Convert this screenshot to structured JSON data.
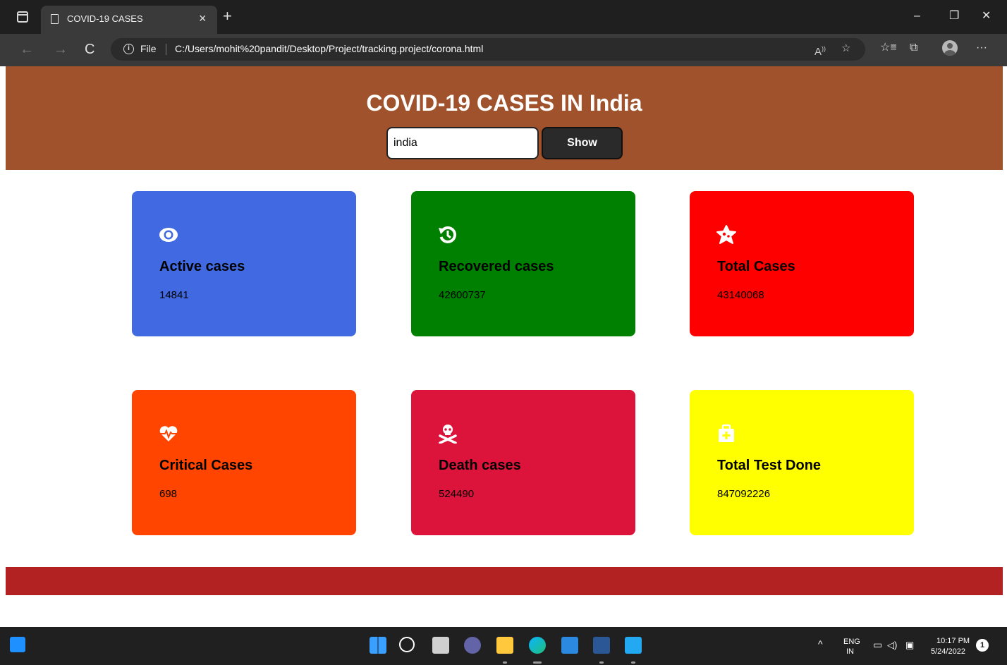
{
  "browser": {
    "tab_title": "COVID-19 CASES",
    "tab_close": "×",
    "new_tab": "+",
    "window_controls": {
      "minimize": "–",
      "restore": "❐",
      "close": "✕"
    },
    "nav": {
      "back": "←",
      "forward": "→",
      "refresh": "C"
    },
    "address": {
      "info_glyph": "i",
      "scheme_label": "File",
      "url": "C:/Users/mohit%20pandit/Desktop/Project/tracking.project/corona.html"
    },
    "toolbar_icons": [
      "read-aloud-icon",
      "add-favorite-icon",
      "favorites-icon",
      "collections-icon",
      "profile-icon",
      "more-icon"
    ],
    "more_label": "···"
  },
  "header": {
    "title": "COVID-19 CASES IN India",
    "search_value": "india",
    "show_label": "Show",
    "background": "#a0522d"
  },
  "cards": [
    {
      "label": "Active cases",
      "value": "14841",
      "color": "#4169e1",
      "icon": "eye-icon"
    },
    {
      "label": "Recovered cases",
      "value": "42600737",
      "color": "#008000",
      "icon": "history-icon"
    },
    {
      "label": "Total Cases",
      "value": "43140068",
      "color": "#ff0000",
      "icon": "virus-icon"
    },
    {
      "label": "Critical Cases",
      "value": "698",
      "color": "#ff4500",
      "icon": "heartbeat-icon"
    },
    {
      "label": "Death cases",
      "value": "524490",
      "color": "#dc143c",
      "icon": "skull-crossbones-icon"
    },
    {
      "label": "Total Test Done",
      "value": "847092226",
      "color": "#ffff00",
      "icon": "medkit-icon"
    }
  ],
  "footer": {
    "color": "#b22222"
  },
  "taskbar": {
    "language": "ENG",
    "region": "IN",
    "time": "10:17 PM",
    "date": "5/24/2022",
    "notification_count": "1",
    "tray_chevron": "^"
  }
}
